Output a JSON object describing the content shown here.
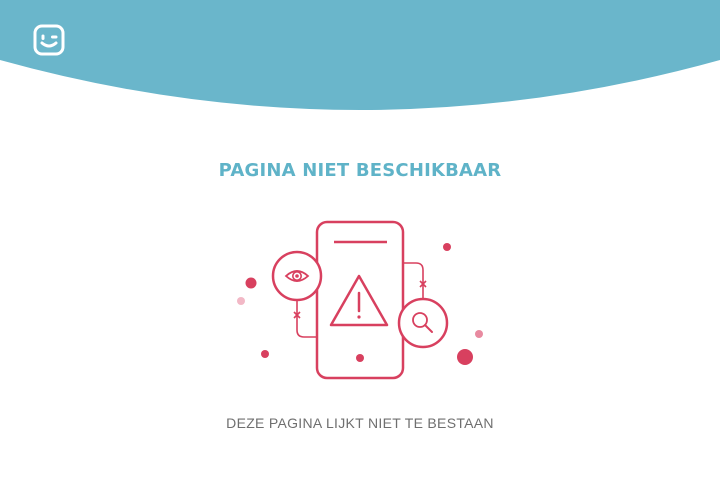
{
  "header": {
    "background_color": "#6ab6cb",
    "logo_icon": "smiley-wink-icon"
  },
  "main": {
    "title": "PAGINA NIET BESCHIKBAAR",
    "subtitle": "DEZE PAGINA LIJKT NIET TE BESTAAN"
  },
  "illustration": {
    "icons": [
      "phone-icon",
      "warning-triangle-icon",
      "eye-icon",
      "magnifier-icon"
    ],
    "accent_color": "#d8405f"
  },
  "colors": {
    "title": "#5fb3c8",
    "subtitle": "#6f6f6f",
    "accent": "#d8405f"
  }
}
